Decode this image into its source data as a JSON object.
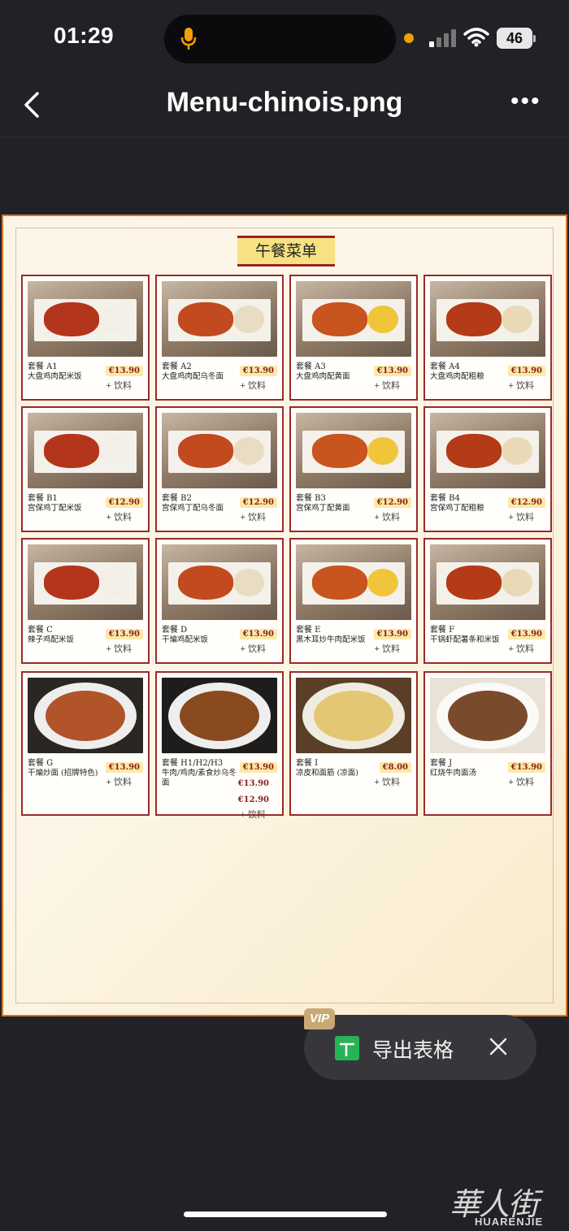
{
  "status_bar": {
    "time": "01:29",
    "battery": "46"
  },
  "nav": {
    "title": "Menu-chinois.png"
  },
  "menu": {
    "heading": "午餐菜单",
    "items": [
      {
        "code": "套餐 A1",
        "name": "大盘鸡肉配米饭",
        "price": "€13.90",
        "drink": "+ 饮料"
      },
      {
        "code": "套餐 A2",
        "name": "大盘鸡肉配乌冬面",
        "price": "€13.90",
        "drink": "+ 饮料"
      },
      {
        "code": "套餐 A3",
        "name": "大盘鸡肉配黄面",
        "price": "€13.90",
        "drink": "+ 饮料"
      },
      {
        "code": "套餐 A4",
        "name": "大盘鸡肉配粗粮",
        "price": "€13.90",
        "drink": "+ 饮料"
      },
      {
        "code": "套餐 B1",
        "name": "宫保鸡丁配米饭",
        "price": "€12.90",
        "drink": "+ 饮料"
      },
      {
        "code": "套餐 B2",
        "name": "宫保鸡丁配乌冬面",
        "price": "€12.90",
        "drink": "+ 饮料"
      },
      {
        "code": "套餐 B3",
        "name": "宫保鸡丁配黄面",
        "price": "€12.90",
        "drink": "+ 饮料"
      },
      {
        "code": "套餐 B4",
        "name": "宫保鸡丁配粗粮",
        "price": "€12.90",
        "drink": "+ 饮料"
      },
      {
        "code": "套餐 C",
        "name": "辣子鸡配米饭",
        "price": "€13.90",
        "drink": "+ 饮料"
      },
      {
        "code": "套餐 D",
        "name": "干煸鸡配米饭",
        "price": "€13.90",
        "drink": "+ 饮料"
      },
      {
        "code": "套餐 E",
        "name": "黑木耳炒牛肉配米饭",
        "price": "€13.90",
        "drink": "+ 饮料"
      },
      {
        "code": "套餐 F",
        "name": "干锅虾配薯条和米饭",
        "price": "€13.90",
        "drink": "+ 饮料"
      },
      {
        "code": "套餐 G",
        "name": "干煸炒面 (招牌特色)",
        "price": "€13.90",
        "drink": "+ 饮料"
      },
      {
        "code": "套餐 H1/H2/H3",
        "name": "牛肉/鸡肉/素食炒乌冬面",
        "price": "€13.90",
        "price2": "€13.90",
        "price3": "€12.90",
        "drink": "+ 饮料"
      },
      {
        "code": "套餐 I",
        "name": "凉皮和面筋 (凉面)",
        "price": "€8.00",
        "drink": "+ 饮料"
      },
      {
        "code": "套餐 J",
        "name": "红烧牛肉面汤",
        "price": "€13.90",
        "drink": "+ 饮料"
      }
    ]
  },
  "toast": {
    "vip_badge": "VIP",
    "label": "导出表格",
    "icon": "spreadsheet-icon"
  },
  "watermark": {
    "cn": "華人街",
    "en": "HUARENJIE"
  },
  "colors": {
    "background": "#222226",
    "card_border": "#9a2a2a",
    "heading_bg": "#f7e181",
    "toast_bg": "#37373b",
    "sheet_green": "#27b457"
  }
}
